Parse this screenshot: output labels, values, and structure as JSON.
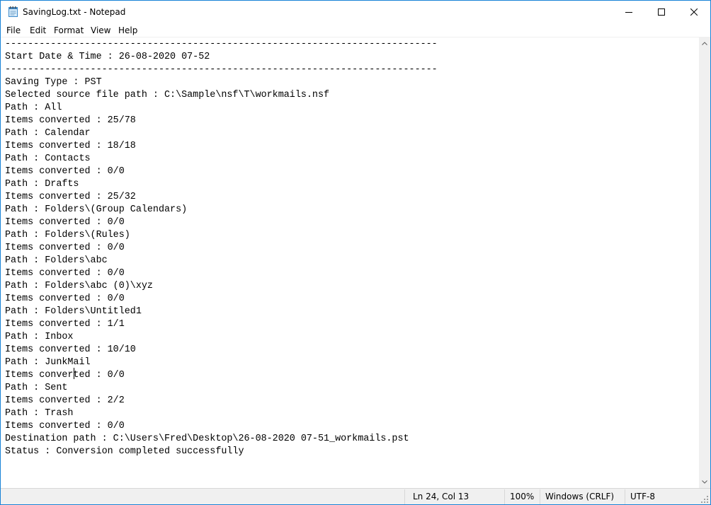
{
  "window": {
    "title": "SavingLog.txt - Notepad",
    "accent_color": "#1883d7",
    "app_icon": "notepad-icon"
  },
  "menu": {
    "file": "File",
    "edit": "Edit",
    "format": "Format",
    "view": "View",
    "help": "Help"
  },
  "document": {
    "lines": [
      "----------------------------------------------------------------------------",
      "Start Date & Time : 26-08-2020 07-52",
      "----------------------------------------------------------------------------",
      "Saving Type : PST",
      "Selected source file path : C:\\Sample\\nsf\\T\\workmails.nsf",
      "Path : All",
      "Items converted : 25/78",
      "Path : Calendar",
      "Items converted : 18/18",
      "Path : Contacts",
      "Items converted : 0/0",
      "Path : Drafts",
      "Items converted : 25/32",
      "Path : Folders\\(Group Calendars)",
      "Items converted : 0/0",
      "Path : Folders\\(Rules)",
      "Items converted : 0/0",
      "Path : Folders\\abc",
      "Items converted : 0/0",
      "Path : Folders\\abc (0)\\xyz",
      "Items converted : 0/0",
      "Path : Folders\\Untitled1",
      "Items converted : 1/1",
      "Path : Inbox",
      "Items converted : 10/10",
      "Path : JunkMail",
      "Items converted : 0/0",
      "Path : Sent",
      "Items converted : 2/2",
      "Path : Trash",
      "Items converted : 0/0",
      "Destination path : C:\\Users\\Fred\\Desktop\\26-08-2020 07-51_workmails.pst",
      "Status : Conversion completed successfully"
    ]
  },
  "status": {
    "position": "Ln 24, Col 13",
    "zoom": "100%",
    "line_ending": "Windows (CRLF)",
    "encoding": "UTF-8"
  }
}
